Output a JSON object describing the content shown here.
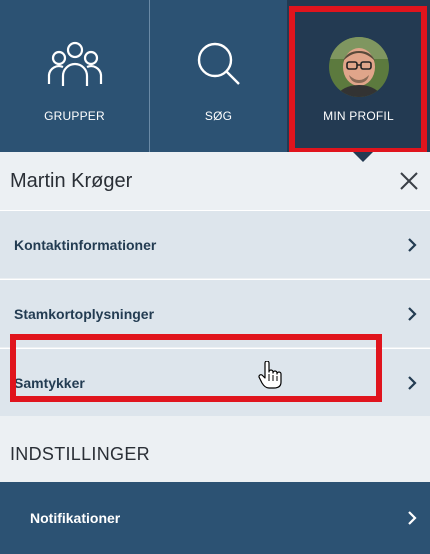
{
  "nav": {
    "items": [
      {
        "label": "GRUPPER",
        "icon": "groups-icon"
      },
      {
        "label": "SØG",
        "icon": "search-icon"
      },
      {
        "label": "MIN PROFIL",
        "icon": "avatar"
      }
    ]
  },
  "profile": {
    "name": "Martin Krøger",
    "close_icon": "close-icon"
  },
  "menu": {
    "items": [
      {
        "label": "Kontaktinformationer"
      },
      {
        "label": "Stamkortoplysninger"
      },
      {
        "label": "Samtykker"
      }
    ]
  },
  "settings": {
    "title": "INDSTILLINGER",
    "notifications_label": "Notifikationer"
  },
  "colors": {
    "nav_bg": "#2c5273",
    "nav_active_bg": "#233a52",
    "highlight": "#e0141d",
    "menu_bg": "#dde5ec",
    "panel_bg": "#ecf0f3"
  }
}
